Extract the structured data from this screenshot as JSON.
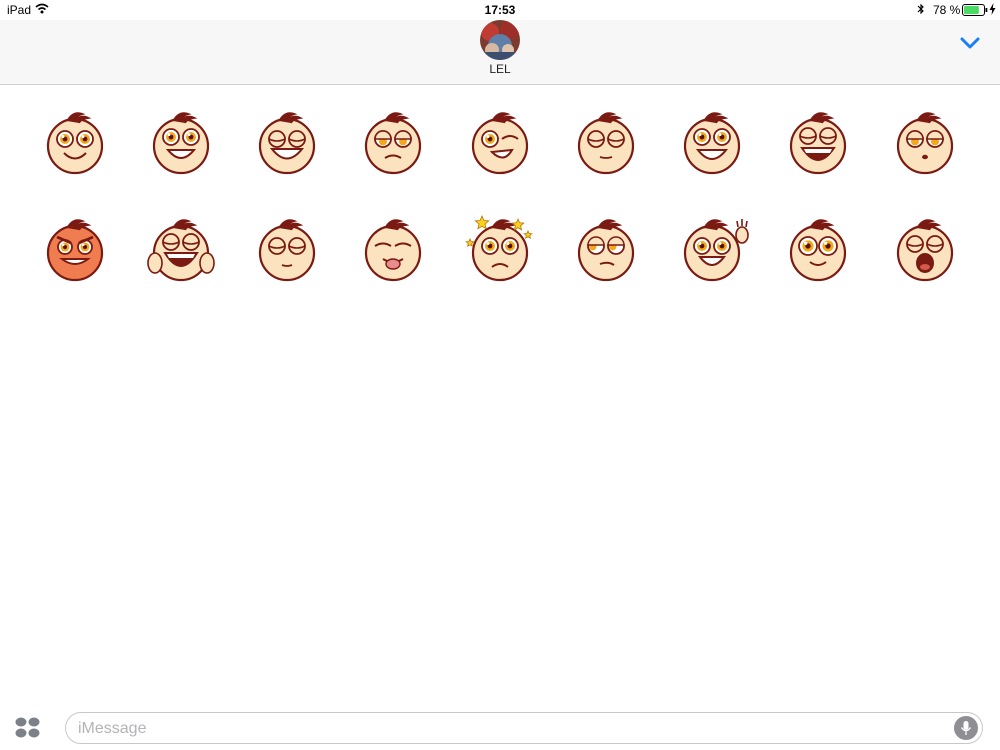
{
  "status_bar": {
    "device": "iPad",
    "time": "17:53",
    "battery_percent": "78 %",
    "battery_level": 0.78,
    "icons": [
      "wifi-icon",
      "bluetooth-icon",
      "battery-icon",
      "charging-bolt-icon"
    ]
  },
  "header": {
    "contact_name": "LEL",
    "collapse_icon": "chevron-down-icon",
    "accent_color": "#1a7ef5"
  },
  "stickers": {
    "rows": [
      [
        "happy",
        "grin",
        "big-smile",
        "annoyed",
        "wink",
        "eyes-closed",
        "laugh",
        "open-laugh",
        "smug"
      ],
      [
        "angry-red",
        "hands-laugh",
        "sleepy",
        "tongue-out",
        "dizzy-stars",
        "sideways-glance",
        "waving",
        "surprised-smile",
        "yawn"
      ]
    ],
    "skin_color": "#fbe3bf",
    "outline_color": "#7a1a12"
  },
  "input": {
    "placeholder": "iMessage",
    "apps_icon": "app-drawer-icon",
    "mic_icon": "microphone-icon"
  }
}
